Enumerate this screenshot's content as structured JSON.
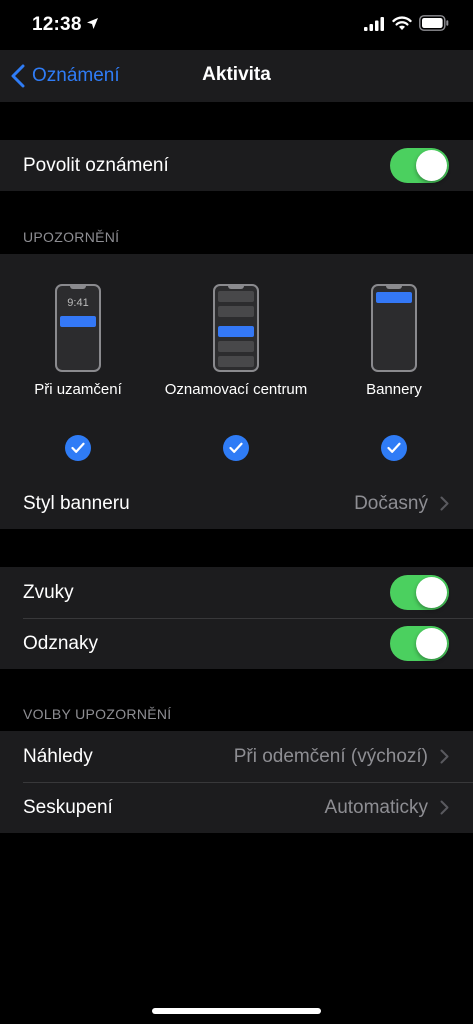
{
  "status_bar": {
    "time": "12:38",
    "icons": [
      "location-arrow-icon",
      "cellular-signal-icon",
      "wifi-icon",
      "battery-icon"
    ]
  },
  "nav": {
    "back_label": "Oznámení",
    "title": "Aktivita"
  },
  "allow_notifications": {
    "label": "Povolit oznámení",
    "on": true
  },
  "alerts_section": {
    "header": "UPOZORNĚNÍ",
    "options": [
      {
        "label": "Při uzamčení",
        "clock": "9:41",
        "checked": true
      },
      {
        "label": "Oznamovací centrum",
        "checked": true
      },
      {
        "label": "Bannery",
        "checked": true
      }
    ],
    "banner_style": {
      "label": "Styl banneru",
      "value": "Dočasný"
    }
  },
  "toggles": [
    {
      "label": "Zvuky",
      "on": true
    },
    {
      "label": "Odznaky",
      "on": true
    }
  ],
  "options_section": {
    "header": "VOLBY UPOZORNĚNÍ",
    "rows": [
      {
        "label": "Náhledy",
        "value": "Při odemčení (výchozí)"
      },
      {
        "label": "Seskupení",
        "value": "Automaticky"
      }
    ]
  },
  "colors": {
    "accent": "#2f7cf6",
    "toggle_on": "#4bd05f",
    "cell_bg": "#1c1c1e",
    "secondary_text": "#8e8e93"
  }
}
